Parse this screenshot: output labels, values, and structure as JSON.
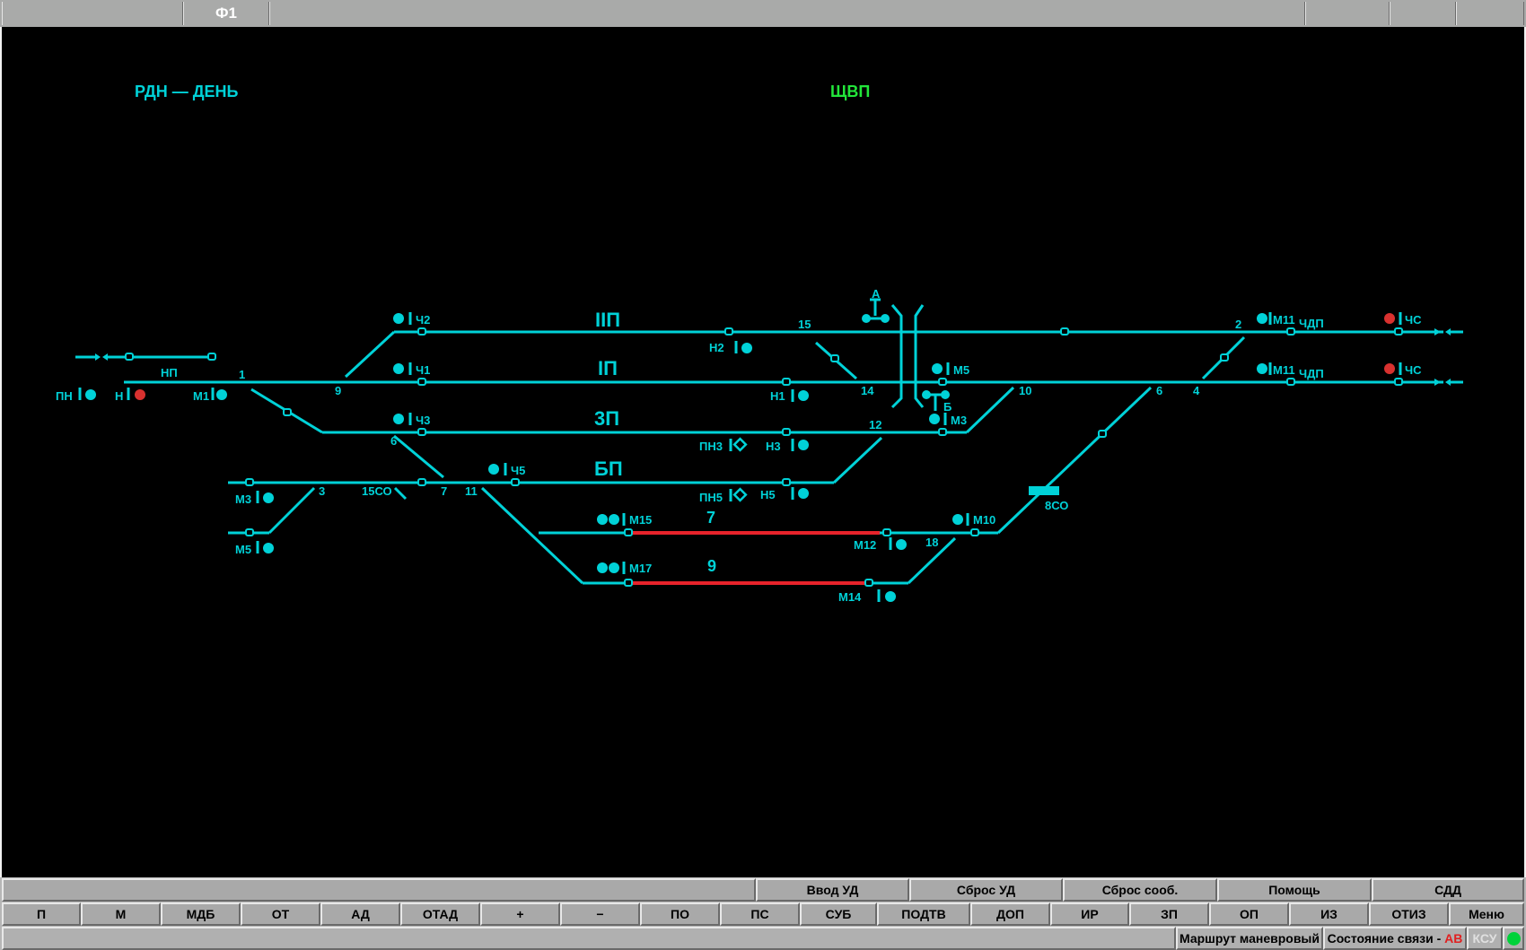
{
  "top_bar": {
    "frame_label": "Ф1"
  },
  "headers": {
    "mode": "РДН — ДЕНЬ",
    "control": "ЩВП"
  },
  "colors": {
    "track": "#00d2d8",
    "occupied": "#e8232b",
    "signal_red": "#d8312f",
    "header_green": "#22e63a",
    "status_ok": "#00d23a"
  },
  "tracks": [
    {
      "id": "IIП",
      "label": "IIП"
    },
    {
      "id": "IП",
      "label": "IП"
    },
    {
      "id": "3П",
      "label": "3П"
    },
    {
      "id": "БП",
      "label": "БП"
    },
    {
      "id": "7",
      "label": "7",
      "state": "occupied"
    },
    {
      "id": "9",
      "label": "9",
      "state": "occupied"
    }
  ],
  "signals": {
    "ch2": "Ч2",
    "ch1": "Ч1",
    "ch3": "Ч3",
    "ch5": "Ч5",
    "h2": "Н2",
    "h1": "Н1",
    "h3": "Н3",
    "h5": "Н5",
    "pn3": "ПН3",
    "pn5": "ПН5",
    "m1": "М1",
    "m3_left": "М3",
    "m5_left": "М5",
    "m5_right": "М5",
    "m3_right": "М3",
    "m10": "М10",
    "m12": "М12",
    "m14": "М14",
    "m15": "М15",
    "m17": "М17",
    "m11_top": "М11",
    "m11_bottom": "М11",
    "cdp_top": "ЧДП",
    "cdp_bottom": "ЧДП",
    "chs_top": "ЧС",
    "chs_bottom": "ЧС",
    "pn": "ПН",
    "n": "Н",
    "np": "НП"
  },
  "switches": [
    "1",
    "9",
    "6",
    "3",
    "15СО",
    "7",
    "11",
    "15",
    "14",
    "12",
    "10",
    "6",
    "4",
    "2",
    "18",
    "8СО"
  ],
  "crossing_labels": {
    "a": "А",
    "b": "Б"
  },
  "toolbar_row1": [
    "Ввод УД",
    "Сброс УД",
    "Сброс сооб.",
    "Помощь",
    "СДД"
  ],
  "toolbar_row2": [
    "П",
    "М",
    "МДБ",
    "ОТ",
    "АД",
    "ОТАД",
    "+",
    "−",
    "ПО",
    "ПС",
    "СУБ",
    "ПОДТВ",
    "ДОП",
    "ИР",
    "ЗП",
    "ОП",
    "ИЗ",
    "ОТИЗ",
    "Меню"
  ],
  "status_bar": {
    "route": "Маршрут маневровый",
    "connection_prefix": "Состояние связи - ",
    "conn_a": "А",
    "conn_b": "В",
    "ksu": "КСУ"
  }
}
